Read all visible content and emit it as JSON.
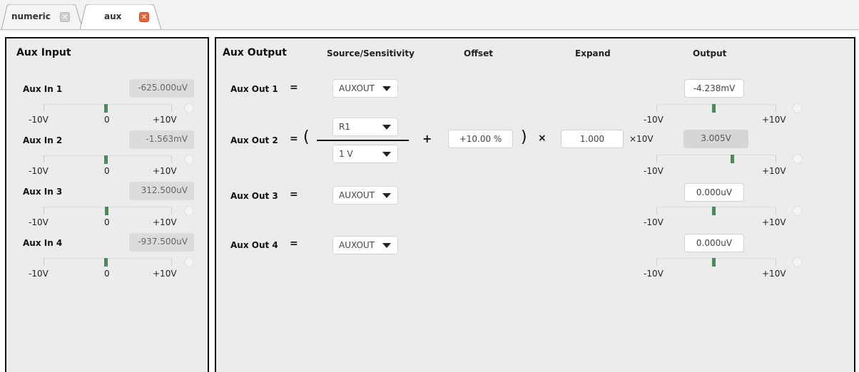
{
  "tabs": [
    {
      "label": "numeric",
      "active": false
    },
    {
      "label": "aux",
      "active": true
    }
  ],
  "tab_close_glyph": "✕",
  "aux_input": {
    "title": "Aux Input",
    "rows": [
      {
        "label": "Aux In 1",
        "value": "-625.000uV",
        "min": "-10V",
        "zero": "0",
        "max": "+10V"
      },
      {
        "label": "Aux In 2",
        "value": "-1.563mV",
        "min": "-10V",
        "zero": "0",
        "max": "+10V"
      },
      {
        "label": "Aux In 3",
        "value": "312.500uV",
        "min": "-10V",
        "zero": "0",
        "max": "+10V"
      },
      {
        "label": "Aux In 4",
        "value": "-937.500uV",
        "min": "-10V",
        "zero": "0",
        "max": "+10V"
      }
    ]
  },
  "aux_output": {
    "title": "Aux Output",
    "headers": {
      "source": "Source/Sensitivity",
      "offset": "Offset",
      "expand": "Expand",
      "output": "Output"
    },
    "rows": [
      {
        "label": "Aux Out 1",
        "equals": "=",
        "source": "AUXOUT",
        "output": "-4.238mV",
        "min": "-10V",
        "max": "+10V"
      },
      {
        "label": "Aux Out 2",
        "equals": "=",
        "open_paren": "(",
        "source_top": "R1",
        "source_bottom": "1 V",
        "plus": "+",
        "offset": "+10.00 %",
        "close_paren": ")",
        "times": "×",
        "expand": "1.000",
        "expand_unit": "×10V",
        "output": "3.005V",
        "min": "-10V",
        "max": "+10V"
      },
      {
        "label": "Aux Out 3",
        "equals": "=",
        "source": "AUXOUT",
        "output": "0.000uV",
        "min": "-10V",
        "max": "+10V"
      },
      {
        "label": "Aux Out 4",
        "equals": "=",
        "source": "AUXOUT",
        "output": "0.000uV",
        "min": "-10V",
        "max": "+10V"
      }
    ]
  },
  "colors": {
    "meter_mark": "#4c8a5a",
    "active_close": "#e8643c",
    "panel_bg": "#ececec"
  }
}
